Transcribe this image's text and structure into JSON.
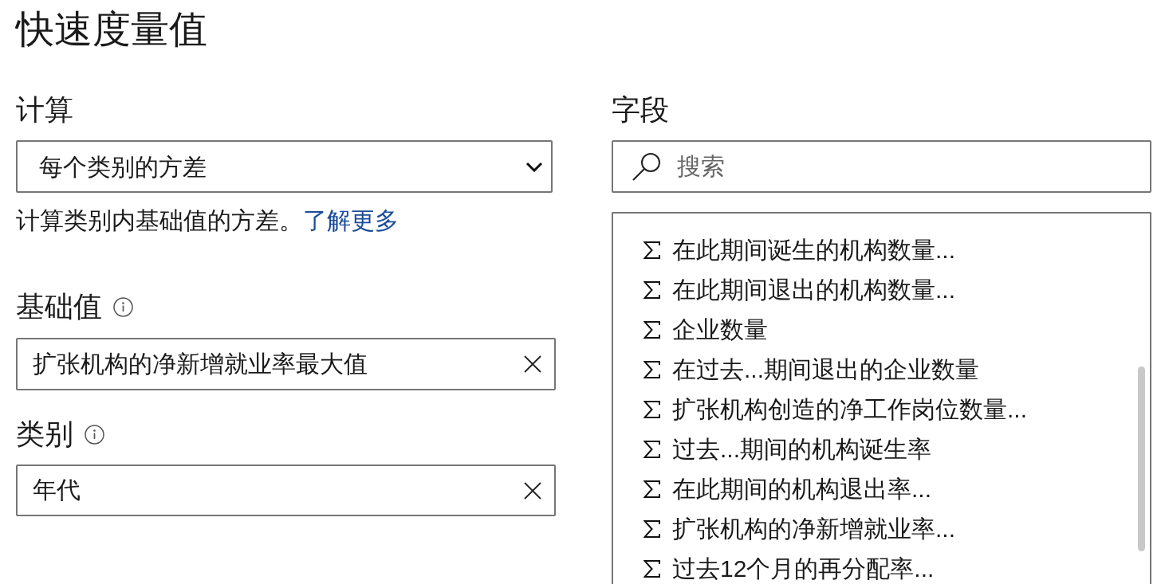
{
  "title": "快速度量值",
  "calculation": {
    "label": "计算",
    "value": "每个类别的方差",
    "description": "计算类别内基础值的方差。",
    "link": "了解更多"
  },
  "base_value": {
    "label": "基础值",
    "value": "扩张机构的净新增就业率最大值"
  },
  "category": {
    "label": "类别",
    "value": "年代"
  },
  "fields": {
    "label": "字段",
    "search": {
      "placeholder": "搜索"
    },
    "items": [
      "在此期间诞生的机构数量...",
      "在此期间退出的机构数量...",
      "企业数量",
      "在过去...期间退出的企业数量",
      "扩张机构创造的净工作岗位数量...",
      "过去...期间的机构诞生率",
      "在此期间的机构退出率...",
      "扩张机构的净新增就业率...",
      "过去12个月的再分配率..."
    ]
  }
}
